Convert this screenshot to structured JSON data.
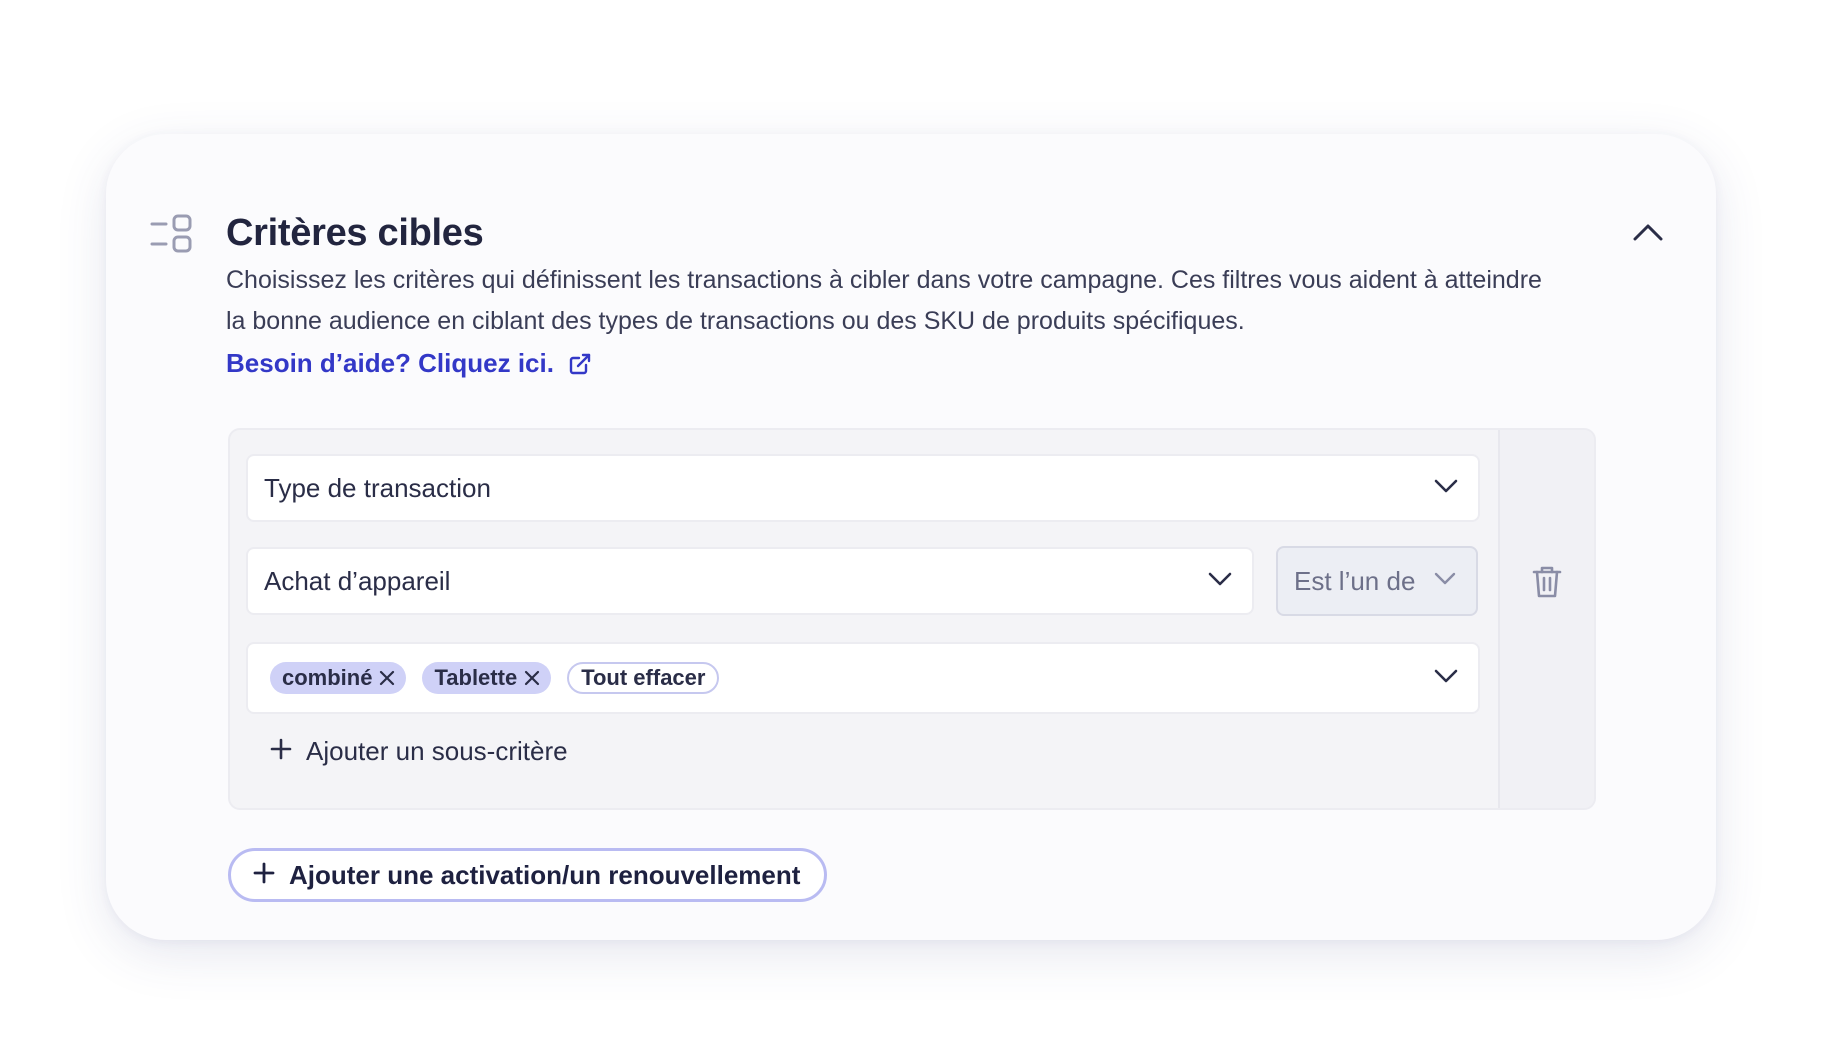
{
  "section": {
    "title": "Critères cibles",
    "description": "Choisissez les critères qui définissent les transactions à cibler dans votre campagne. Ces filtres vous aident à atteindre la bonne audience en ciblant des types de transactions ou des SKU de produits spécifiques.",
    "help_link": "Besoin d’aide? Cliquez ici.",
    "icon": "criteria-list-icon",
    "collapse_icon": "chevron-up-icon"
  },
  "criteria": {
    "type_select": {
      "value": "Type de transaction"
    },
    "subtype_select": {
      "value": "Achat d’appareil"
    },
    "operator_select": {
      "value": "Est l’un de"
    },
    "values_select": {
      "chips": [
        "combiné",
        "Tablette"
      ],
      "clear_all": "Tout effacer"
    },
    "add_sub_criterion": "Ajouter un sous-critère",
    "delete_icon": "trash-icon"
  },
  "add_activation": "Ajouter une activation/un renouvellement",
  "colors": {
    "accent": "#3338c7",
    "chip_bg": "#cfd1f7",
    "text": "#1e2140"
  }
}
